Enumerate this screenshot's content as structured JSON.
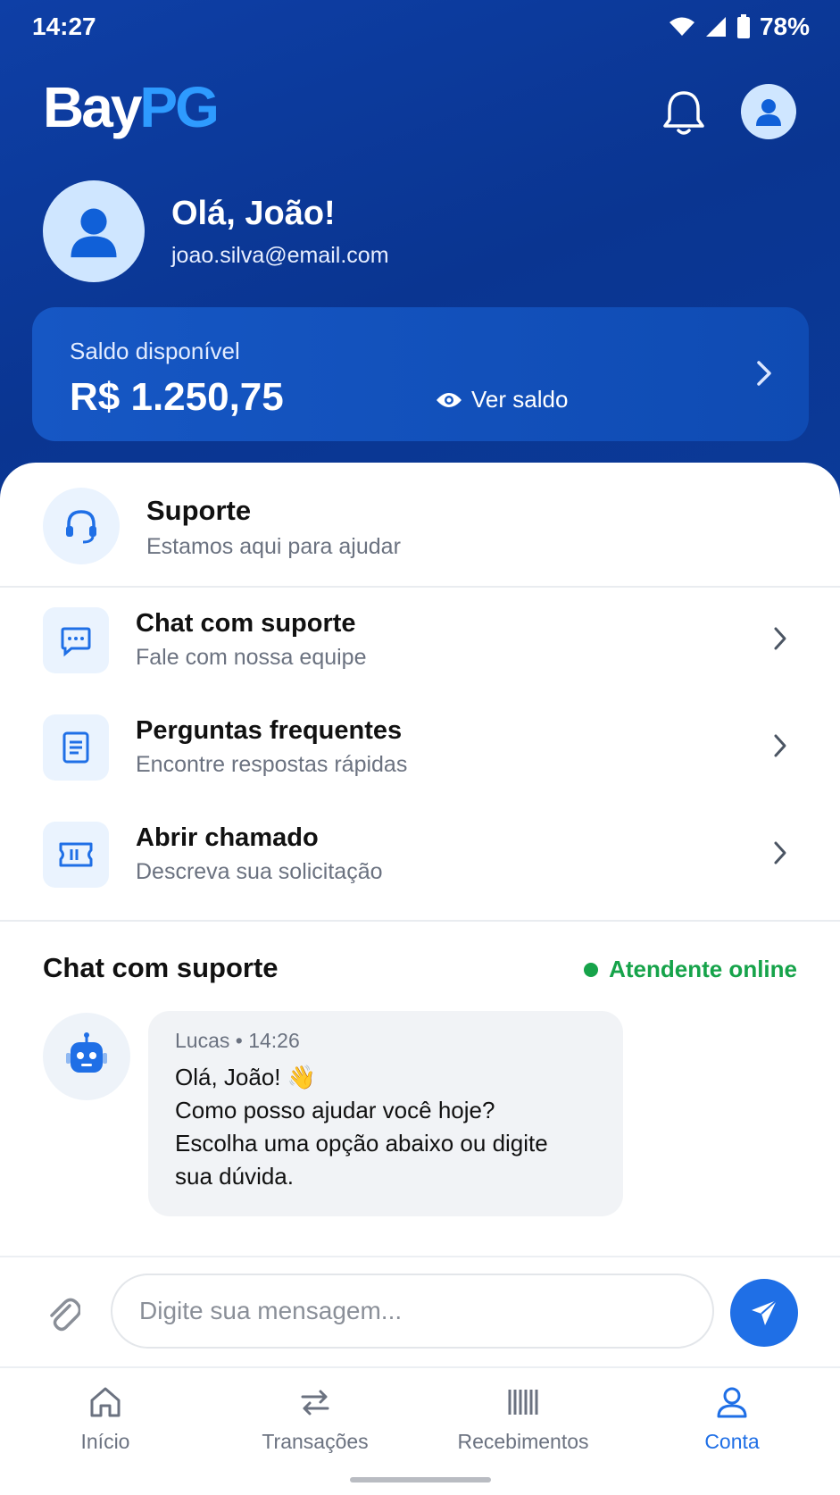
{
  "status_bar": {
    "time": "14:27",
    "battery": "78%"
  },
  "app": {
    "logo_part1": "Bay",
    "logo_part2": "PG"
  },
  "profile": {
    "greeting": "Olá, João!",
    "email": "joao.silva@email.com"
  },
  "balance": {
    "label": "Saldo disponível",
    "value": "R$ 1.250,75",
    "toggle_label": "Ver saldo"
  },
  "support": {
    "title": "Suporte",
    "subtitle": "Estamos aqui para ajudar",
    "items": [
      {
        "title": "Chat com suporte",
        "subtitle": "Fale com nossa equipe",
        "icon": "chat-bubble-icon"
      },
      {
        "title": "Perguntas frequentes",
        "subtitle": "Encontre respostas rápidas",
        "icon": "document-icon"
      },
      {
        "title": "Abrir chamado",
        "subtitle": "Descreva sua solicitação",
        "icon": "ticket-icon"
      }
    ]
  },
  "chat": {
    "title": "Chat com suporte",
    "status": "Atendente online",
    "message": {
      "meta": "Lucas • 14:26",
      "line1": "Olá, João! 👋",
      "line2": "Como posso ajudar você hoje?",
      "line3": "Escolha uma opção abaixo ou digite",
      "line4": "sua dúvida."
    }
  },
  "composer": {
    "placeholder": "Digite sua mensagem..."
  },
  "nav": {
    "tabs": [
      {
        "label": "Início",
        "icon": "home-icon"
      },
      {
        "label": "Transações",
        "icon": "transfer-arrows-icon"
      },
      {
        "label": "Recebimentos",
        "icon": "barcode-icon"
      },
      {
        "label": "Conta",
        "icon": "user-icon",
        "active": true
      }
    ]
  },
  "colors": {
    "header": "#0a3591",
    "accent": "#1f6fe6",
    "online": "#16a34a",
    "logo_accent": "#2e9bff"
  }
}
